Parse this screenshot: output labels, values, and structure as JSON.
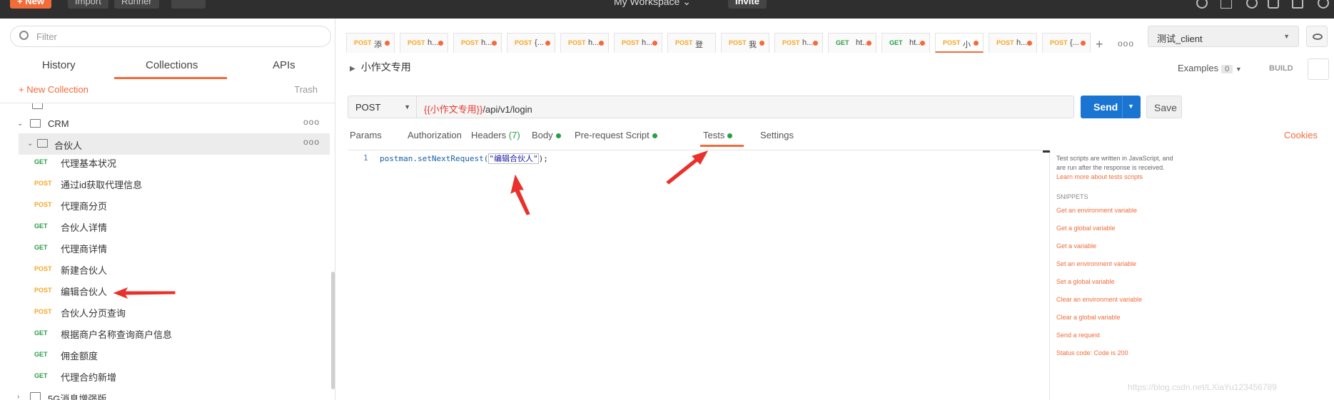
{
  "topbar": {
    "new_label": "New",
    "import_label": "Import",
    "runner_label": "Runner",
    "workspace_label": "My Workspace",
    "invite_label": "Invite"
  },
  "sidebar": {
    "filter_placeholder": "Filter",
    "tabs": [
      "History",
      "Collections",
      "APIs"
    ],
    "new_collection_label": "+ New Collection",
    "trash_label": "Trash",
    "folders": [
      {
        "label": "CRM"
      },
      {
        "label": "合伙人"
      },
      {
        "label": "5G消息增强版"
      }
    ],
    "requests": [
      {
        "method": "GET",
        "label": "代理基本状况"
      },
      {
        "method": "POST",
        "label": "通过id获取代理信息"
      },
      {
        "method": "POST",
        "label": "代理商分页"
      },
      {
        "method": "GET",
        "label": "合伙人详情"
      },
      {
        "method": "GET",
        "label": "代理商详情"
      },
      {
        "method": "POST",
        "label": "新建合伙人"
      },
      {
        "method": "POST",
        "label": "编辑合伙人"
      },
      {
        "method": "POST",
        "label": "合伙人分页查询"
      },
      {
        "method": "GET",
        "label": "根据商户名称查询商户信息"
      },
      {
        "method": "GET",
        "label": "佣金额度"
      },
      {
        "method": "GET",
        "label": "代理合约新增"
      }
    ]
  },
  "request_tabs": [
    {
      "method": "POST",
      "name": "添"
    },
    {
      "method": "POST",
      "name": "h..."
    },
    {
      "method": "POST",
      "name": "h..."
    },
    {
      "method": "POST",
      "name": "{..."
    },
    {
      "method": "POST",
      "name": "h..."
    },
    {
      "method": "POST",
      "name": "h..."
    },
    {
      "method": "POST",
      "name": "登"
    },
    {
      "method": "POST",
      "name": "我"
    },
    {
      "method": "POST",
      "name": "h..."
    },
    {
      "method": "GET",
      "name": "ht..."
    },
    {
      "method": "GET",
      "name": "ht..."
    },
    {
      "method": "POST",
      "name": "小"
    },
    {
      "method": "POST",
      "name": "h..."
    },
    {
      "method": "POST",
      "name": "{..."
    }
  ],
  "environment": {
    "selected": "测试_client"
  },
  "request": {
    "name": "小作文专用",
    "examples_label": "Examples",
    "examples_count": "0",
    "build_label": "BUILD",
    "method": "POST",
    "url_var": "{{小作文专用}}",
    "url_path": "/api/v1/login",
    "send_label": "Send",
    "save_label": "Save"
  },
  "subtabs": {
    "params": "Params",
    "authorization": "Authorization",
    "headers": "Headers",
    "headers_count": "(7)",
    "body": "Body",
    "prerequest": "Pre-request Script",
    "tests": "Tests",
    "settings": "Settings",
    "cookies": "Cookies"
  },
  "editor": {
    "line_number": "1",
    "code_prefix": "postman.setNextRequest(",
    "code_string": "\"编辑合伙人\"",
    "code_suffix": ");"
  },
  "snippets": {
    "description": "Test scripts are written in JavaScript, and are run after the response is received.",
    "learn_more": "Learn more about tests scripts",
    "heading": "SNIPPETS",
    "items": [
      "Get an environment variable",
      "Get a global variable",
      "Get a variable",
      "Set an environment variable",
      "Set a global variable",
      "Clear an environment variable",
      "Clear a global variable",
      "Send a request",
      "Status code: Code is 200"
    ]
  },
  "watermark": "https://blog.csdn.net/LXiaYu123456789",
  "colors": {
    "accent": "#f26b3a",
    "send": "#1a75d2",
    "get": "#2a9d45",
    "post": "#f5a623",
    "annotation": "#e8312a"
  }
}
